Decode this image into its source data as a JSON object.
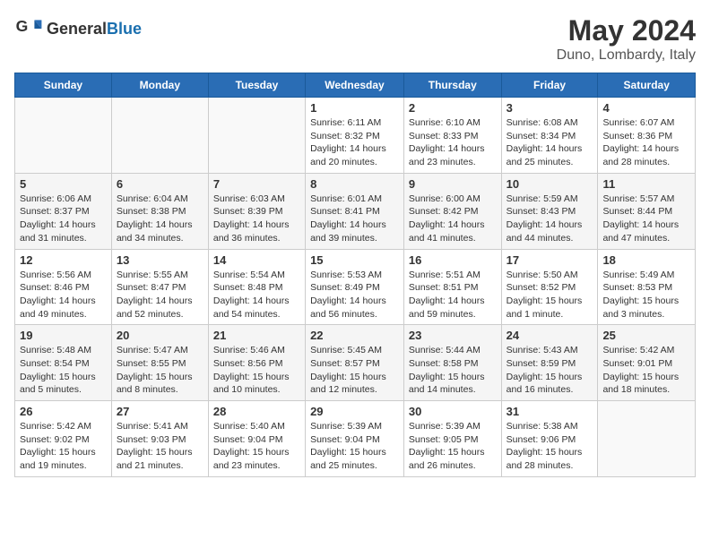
{
  "header": {
    "logo_general": "General",
    "logo_blue": "Blue",
    "title": "May 2024",
    "subtitle": "Duno, Lombardy, Italy"
  },
  "weekdays": [
    "Sunday",
    "Monday",
    "Tuesday",
    "Wednesday",
    "Thursday",
    "Friday",
    "Saturday"
  ],
  "weeks": [
    [
      {
        "day": "",
        "info": ""
      },
      {
        "day": "",
        "info": ""
      },
      {
        "day": "",
        "info": ""
      },
      {
        "day": "1",
        "info": "Sunrise: 6:11 AM\nSunset: 8:32 PM\nDaylight: 14 hours\nand 20 minutes."
      },
      {
        "day": "2",
        "info": "Sunrise: 6:10 AM\nSunset: 8:33 PM\nDaylight: 14 hours\nand 23 minutes."
      },
      {
        "day": "3",
        "info": "Sunrise: 6:08 AM\nSunset: 8:34 PM\nDaylight: 14 hours\nand 25 minutes."
      },
      {
        "day": "4",
        "info": "Sunrise: 6:07 AM\nSunset: 8:36 PM\nDaylight: 14 hours\nand 28 minutes."
      }
    ],
    [
      {
        "day": "5",
        "info": "Sunrise: 6:06 AM\nSunset: 8:37 PM\nDaylight: 14 hours\nand 31 minutes."
      },
      {
        "day": "6",
        "info": "Sunrise: 6:04 AM\nSunset: 8:38 PM\nDaylight: 14 hours\nand 34 minutes."
      },
      {
        "day": "7",
        "info": "Sunrise: 6:03 AM\nSunset: 8:39 PM\nDaylight: 14 hours\nand 36 minutes."
      },
      {
        "day": "8",
        "info": "Sunrise: 6:01 AM\nSunset: 8:41 PM\nDaylight: 14 hours\nand 39 minutes."
      },
      {
        "day": "9",
        "info": "Sunrise: 6:00 AM\nSunset: 8:42 PM\nDaylight: 14 hours\nand 41 minutes."
      },
      {
        "day": "10",
        "info": "Sunrise: 5:59 AM\nSunset: 8:43 PM\nDaylight: 14 hours\nand 44 minutes."
      },
      {
        "day": "11",
        "info": "Sunrise: 5:57 AM\nSunset: 8:44 PM\nDaylight: 14 hours\nand 47 minutes."
      }
    ],
    [
      {
        "day": "12",
        "info": "Sunrise: 5:56 AM\nSunset: 8:46 PM\nDaylight: 14 hours\nand 49 minutes."
      },
      {
        "day": "13",
        "info": "Sunrise: 5:55 AM\nSunset: 8:47 PM\nDaylight: 14 hours\nand 52 minutes."
      },
      {
        "day": "14",
        "info": "Sunrise: 5:54 AM\nSunset: 8:48 PM\nDaylight: 14 hours\nand 54 minutes."
      },
      {
        "day": "15",
        "info": "Sunrise: 5:53 AM\nSunset: 8:49 PM\nDaylight: 14 hours\nand 56 minutes."
      },
      {
        "day": "16",
        "info": "Sunrise: 5:51 AM\nSunset: 8:51 PM\nDaylight: 14 hours\nand 59 minutes."
      },
      {
        "day": "17",
        "info": "Sunrise: 5:50 AM\nSunset: 8:52 PM\nDaylight: 15 hours\nand 1 minute."
      },
      {
        "day": "18",
        "info": "Sunrise: 5:49 AM\nSunset: 8:53 PM\nDaylight: 15 hours\nand 3 minutes."
      }
    ],
    [
      {
        "day": "19",
        "info": "Sunrise: 5:48 AM\nSunset: 8:54 PM\nDaylight: 15 hours\nand 5 minutes."
      },
      {
        "day": "20",
        "info": "Sunrise: 5:47 AM\nSunset: 8:55 PM\nDaylight: 15 hours\nand 8 minutes."
      },
      {
        "day": "21",
        "info": "Sunrise: 5:46 AM\nSunset: 8:56 PM\nDaylight: 15 hours\nand 10 minutes."
      },
      {
        "day": "22",
        "info": "Sunrise: 5:45 AM\nSunset: 8:57 PM\nDaylight: 15 hours\nand 12 minutes."
      },
      {
        "day": "23",
        "info": "Sunrise: 5:44 AM\nSunset: 8:58 PM\nDaylight: 15 hours\nand 14 minutes."
      },
      {
        "day": "24",
        "info": "Sunrise: 5:43 AM\nSunset: 8:59 PM\nDaylight: 15 hours\nand 16 minutes."
      },
      {
        "day": "25",
        "info": "Sunrise: 5:42 AM\nSunset: 9:01 PM\nDaylight: 15 hours\nand 18 minutes."
      }
    ],
    [
      {
        "day": "26",
        "info": "Sunrise: 5:42 AM\nSunset: 9:02 PM\nDaylight: 15 hours\nand 19 minutes."
      },
      {
        "day": "27",
        "info": "Sunrise: 5:41 AM\nSunset: 9:03 PM\nDaylight: 15 hours\nand 21 minutes."
      },
      {
        "day": "28",
        "info": "Sunrise: 5:40 AM\nSunset: 9:04 PM\nDaylight: 15 hours\nand 23 minutes."
      },
      {
        "day": "29",
        "info": "Sunrise: 5:39 AM\nSunset: 9:04 PM\nDaylight: 15 hours\nand 25 minutes."
      },
      {
        "day": "30",
        "info": "Sunrise: 5:39 AM\nSunset: 9:05 PM\nDaylight: 15 hours\nand 26 minutes."
      },
      {
        "day": "31",
        "info": "Sunrise: 5:38 AM\nSunset: 9:06 PM\nDaylight: 15 hours\nand 28 minutes."
      },
      {
        "day": "",
        "info": ""
      }
    ]
  ]
}
